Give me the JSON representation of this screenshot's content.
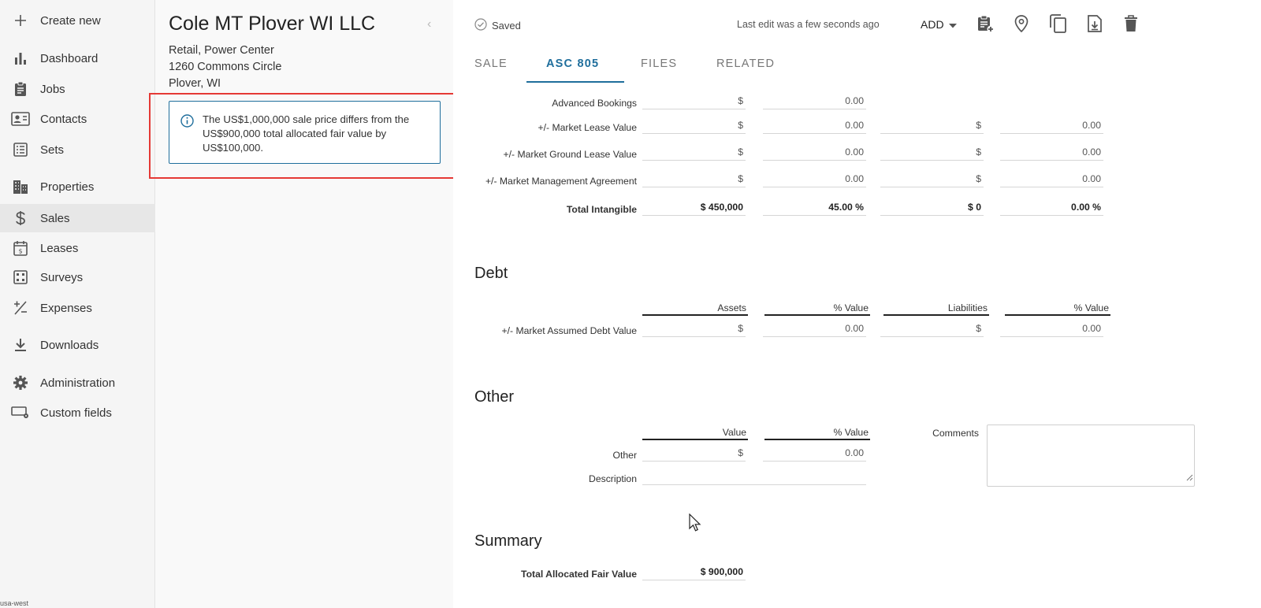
{
  "sidebar": {
    "items": [
      {
        "label": "Create new",
        "icon": "plus-icon"
      },
      {
        "label": "Dashboard",
        "icon": "bar-chart-icon"
      },
      {
        "label": "Jobs",
        "icon": "clipboard-icon"
      },
      {
        "label": "Contacts",
        "icon": "contact-card-icon"
      },
      {
        "label": "Sets",
        "icon": "list-icon"
      },
      {
        "label": "Properties",
        "icon": "buildings-icon"
      },
      {
        "label": "Sales",
        "icon": "dollar-icon",
        "active": true
      },
      {
        "label": "Leases",
        "icon": "lease-calendar-icon"
      },
      {
        "label": "Surveys",
        "icon": "survey-grid-icon"
      },
      {
        "label": "Expenses",
        "icon": "plus-minus-icon"
      },
      {
        "label": "Downloads",
        "icon": "download-icon"
      },
      {
        "label": "Administration",
        "icon": "gear-icon"
      },
      {
        "label": "Custom fields",
        "icon": "custom-fields-icon"
      }
    ],
    "region": "usa-west"
  },
  "detail": {
    "title": "Cole MT Plover WI LLC",
    "type": "Retail, Power Center",
    "address": "1260 Commons Circle",
    "city": "Plover, WI",
    "alert": "The US$1,000,000 sale price differs from the US$900,000 total allocated fair value by US$100,000."
  },
  "header": {
    "saved": "Saved",
    "last_edit": "Last edit was a few seconds ago",
    "add": "ADD",
    "tools": [
      "clipboard-add-icon",
      "map-pin-icon",
      "copy-icon",
      "file-download-icon",
      "trash-icon"
    ]
  },
  "tabs": [
    {
      "label": "SALE"
    },
    {
      "label": "ASC 805",
      "active": true
    },
    {
      "label": "FILES"
    },
    {
      "label": "RELATED"
    }
  ],
  "intangible": {
    "rows": [
      {
        "label": "Advanced Bookings",
        "c1": "$",
        "c2": "0.00"
      },
      {
        "label": "+/- Market Lease Value",
        "c1": "$",
        "c2": "0.00",
        "c3": "$",
        "c4": "0.00"
      },
      {
        "label": "+/- Market Ground Lease Value",
        "c1": "$",
        "c2": "0.00",
        "c3": "$",
        "c4": "0.00"
      },
      {
        "label": "+/- Market Management Agreement",
        "c1": "$",
        "c2": "0.00",
        "c3": "$",
        "c4": "0.00"
      }
    ],
    "total": {
      "label": "Total Intangible",
      "c1": "$ 450,000",
      "c2": "45.00 %",
      "c3": "$ 0",
      "c4": "0.00 %"
    }
  },
  "debt": {
    "title": "Debt",
    "headers": [
      "Assets",
      "% Value",
      "Liabilities",
      "% Value"
    ],
    "row": {
      "label": "+/- Market Assumed Debt Value",
      "c1": "$",
      "c2": "0.00",
      "c3": "$",
      "c4": "0.00"
    }
  },
  "other": {
    "title": "Other",
    "headers": [
      "Value",
      "% Value"
    ],
    "row": {
      "label": "Other",
      "c1": "$",
      "c2": "0.00"
    },
    "description_label": "Description",
    "description_value": "",
    "comments_label": "Comments"
  },
  "summary": {
    "title": "Summary",
    "label": "Total Allocated Fair Value",
    "value": "$ 900,000"
  }
}
